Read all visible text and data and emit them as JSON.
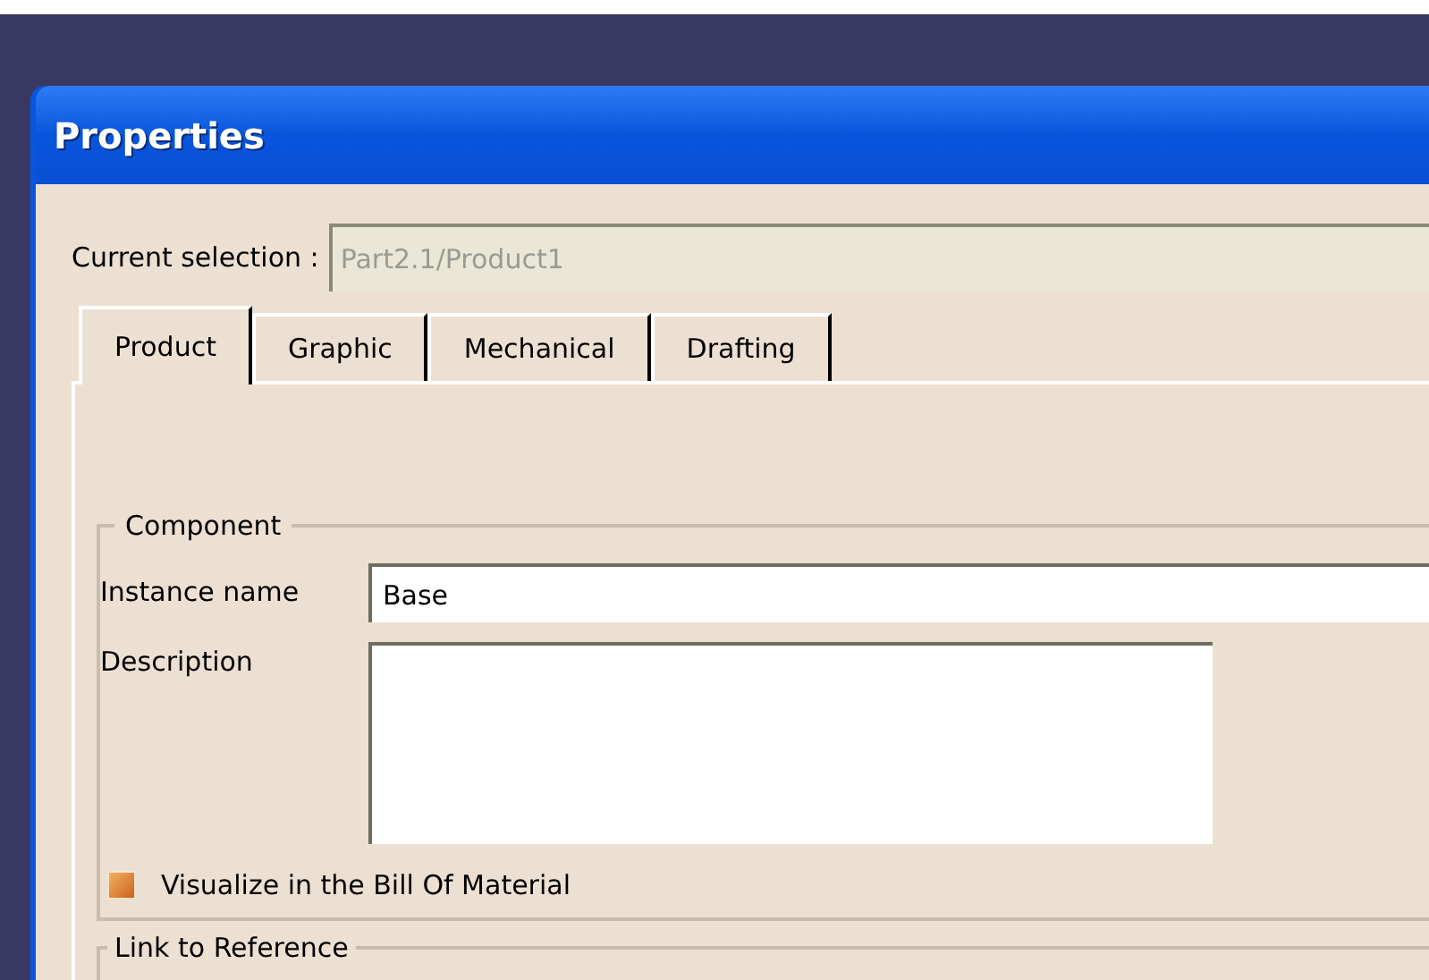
{
  "window": {
    "title": "Properties"
  },
  "current_selection": {
    "label": "Current selection :",
    "value": "Part2.1/Product1"
  },
  "tabs": [
    {
      "label": "Product",
      "selected": true
    },
    {
      "label": "Graphic",
      "selected": false
    },
    {
      "label": "Mechanical",
      "selected": false
    },
    {
      "label": "Drafting",
      "selected": false
    }
  ],
  "component": {
    "legend": "Component",
    "instance_name": {
      "label": "Instance name",
      "value": "Base"
    },
    "description": {
      "label": "Description"
    },
    "bom": {
      "label": "Visualize in the Bill Of Material",
      "checked": true
    }
  },
  "link_to_reference": {
    "legend": "Link to Reference"
  }
}
